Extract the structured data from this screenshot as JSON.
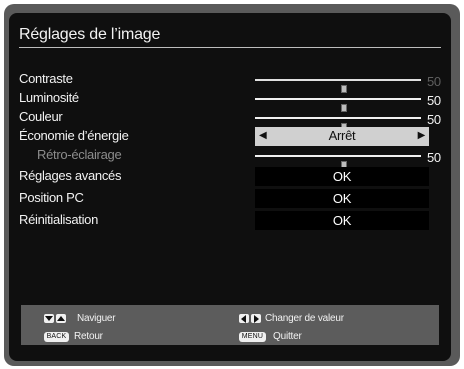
{
  "menu": {
    "title": "Réglages de l’image"
  },
  "settings": {
    "contraste": {
      "label": "Contraste",
      "value": "50",
      "level": 0.5
    },
    "luminosite": {
      "label": "Luminosité",
      "value": "50",
      "level": 0.5
    },
    "couleur": {
      "label": "Couleur",
      "value": "50",
      "level": 0.5
    },
    "economie": {
      "label": "Économie d’énergie",
      "value": "Arrêt"
    },
    "retro": {
      "label": "Rétro-éclairage",
      "value": "50",
      "level": 0.5
    },
    "avances": {
      "label": "Réglages avancés",
      "button": "OK"
    },
    "position_pc": {
      "label": "Position PC",
      "button": "OK"
    },
    "reinit": {
      "label": "Réinitialisation",
      "button": "OK"
    }
  },
  "footer": {
    "naviguer": "Naviguer",
    "retour": "Retour",
    "changer": "Changer de valeur",
    "quitter": "Quitter",
    "back_key": "BACK",
    "menu_key": "MENU"
  },
  "icons": {
    "select_left": "triangle-left",
    "select_right": "triangle-right",
    "nav_keys": "up-down-arrow-keys",
    "change_keys": "left-right-arrow-keys"
  },
  "colors": {
    "background": "#0f0f0f",
    "frame": "#5a5a5a",
    "select_bg": "#d0d0d0",
    "footer_bg": "#5c5c5c"
  }
}
